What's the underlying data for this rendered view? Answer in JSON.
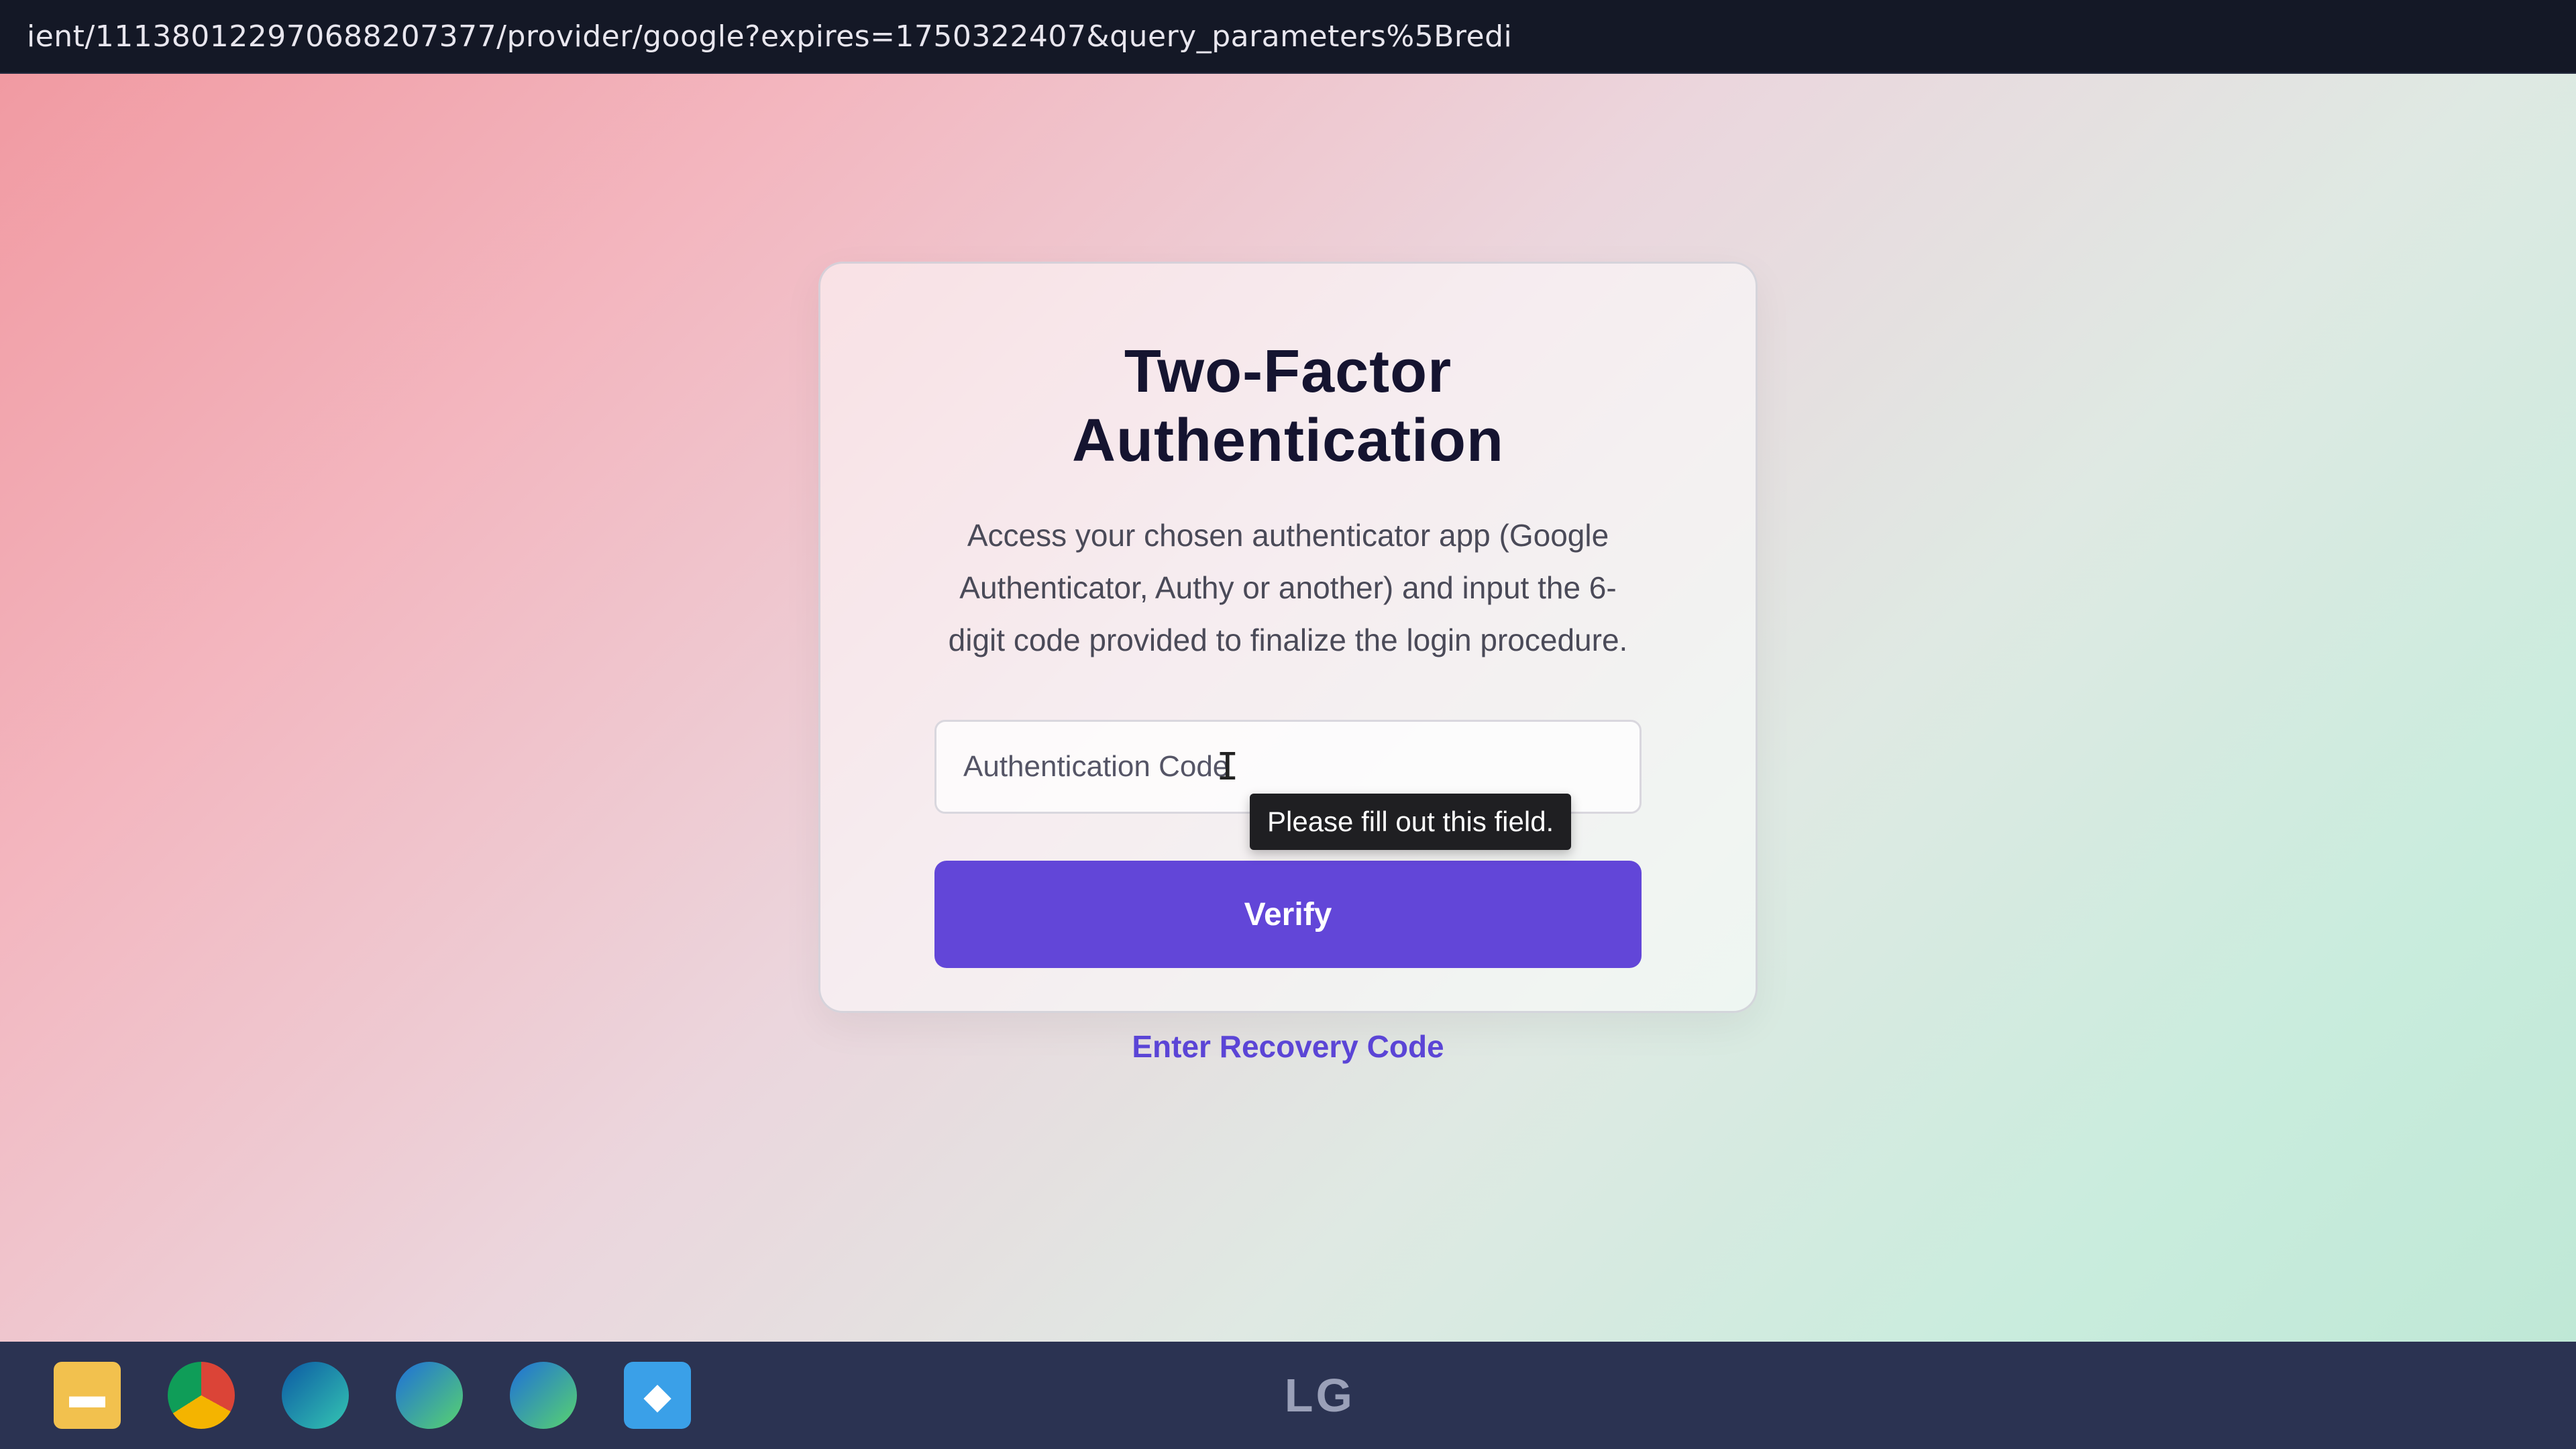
{
  "browser": {
    "url": "ient/1113801229706882073​77/provider/google?expires=1750322407&query_parameters%5Bredi"
  },
  "card": {
    "title": "Two-Factor Authentication",
    "description": "Access your chosen authenticator app (Google Authenticator, Authy or another) and input the 6-digit code provided to finalize the login procedure.",
    "input_placeholder": "Authentication Code",
    "tooltip": "Please fill out this field.",
    "verify_label": "Verify",
    "recovery_label": "Enter Recovery Code"
  },
  "taskbar": {
    "icons": [
      "folder-icon",
      "chrome-icon",
      "edge-icon",
      "edge-beta-icon",
      "edge-dev-icon",
      "app-icon"
    ]
  },
  "monitor": {
    "brand": "LG"
  },
  "colors": {
    "accent": "#6246d8",
    "link": "#5b45d6",
    "title": "#151430"
  }
}
